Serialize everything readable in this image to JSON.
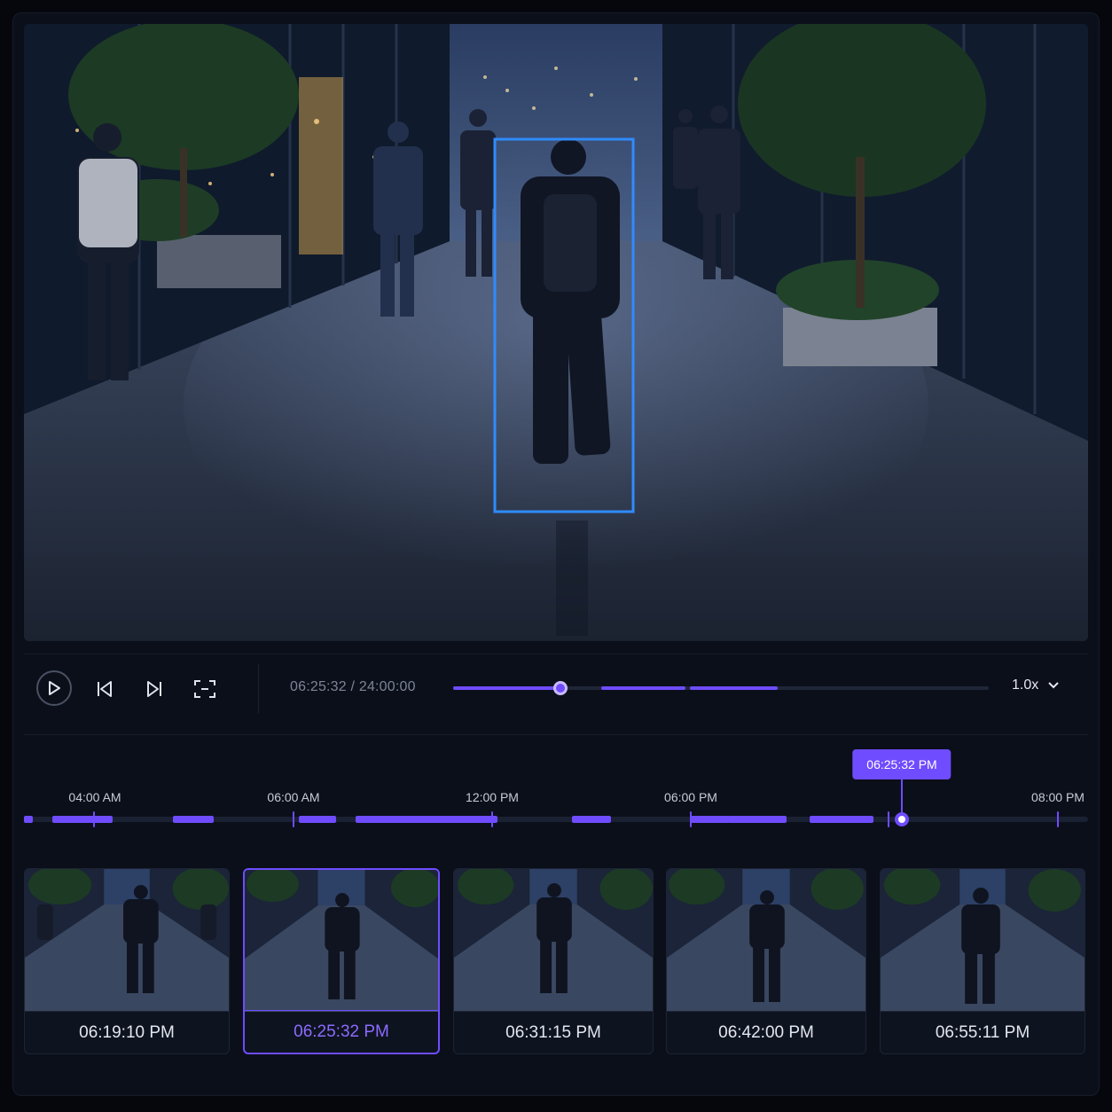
{
  "player": {
    "current_time": "06:25:32",
    "total_time": "24:00:00",
    "speed": "1.0x",
    "progress": 0.2,
    "icons": {
      "play": "play-icon",
      "prev": "skip-back-icon",
      "next": "skip-forward-icon",
      "snapshot": "snapshot-frame-icon",
      "speed": "chevron-down-icon"
    }
  },
  "timeline": {
    "labels": [
      "04:00 AM",
      "06:00 AM",
      "12:00 PM",
      "06:00 PM",
      "08:00 PM"
    ],
    "marker_label": "06:25:32 PM"
  },
  "thumbnails": [
    {
      "time": "06:19:10 PM",
      "selected": false
    },
    {
      "time": "06:25:32 PM",
      "selected": true
    },
    {
      "time": "06:31:15 PM",
      "selected": false
    },
    {
      "time": "06:42:00 PM",
      "selected": false
    },
    {
      "time": "06:55:11 PM",
      "selected": false
    }
  ],
  "colors": {
    "accent": "#6f4cff",
    "detection_box": "#2f8cff",
    "background": "#0b0f1a"
  }
}
